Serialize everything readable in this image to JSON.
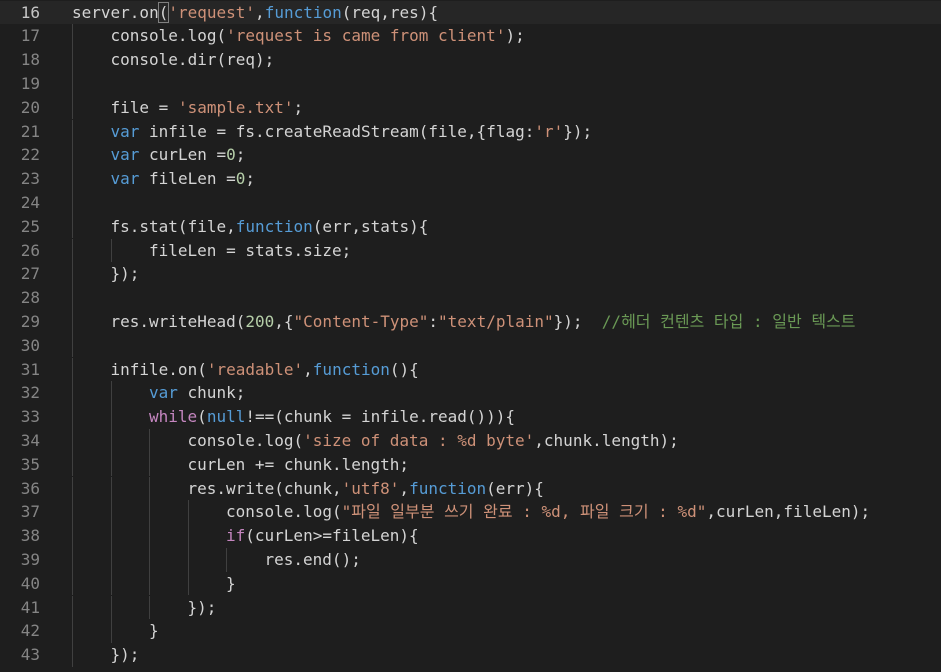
{
  "editor": {
    "current_line": 16,
    "lines": [
      {
        "n": "16",
        "indent": 0,
        "tokens": [
          {
            "t": "server.on",
            "c": "plain"
          },
          {
            "t": "(",
            "c": "br"
          },
          {
            "t": "'request'",
            "c": "str"
          },
          {
            "t": ",",
            "c": "plain"
          },
          {
            "t": "function",
            "c": "kw"
          },
          {
            "t": "(req,res){",
            "c": "plain"
          }
        ]
      },
      {
        "n": "17",
        "indent": 1,
        "tokens": [
          {
            "t": "console.log(",
            "c": "plain"
          },
          {
            "t": "'request is came from client'",
            "c": "str"
          },
          {
            "t": ");",
            "c": "plain"
          }
        ]
      },
      {
        "n": "18",
        "indent": 1,
        "tokens": [
          {
            "t": "console.dir(req);",
            "c": "plain"
          }
        ]
      },
      {
        "n": "19",
        "indent": 0,
        "tokens": []
      },
      {
        "n": "20",
        "indent": 1,
        "tokens": [
          {
            "t": "file = ",
            "c": "plain"
          },
          {
            "t": "'sample.txt'",
            "c": "str"
          },
          {
            "t": ";",
            "c": "plain"
          }
        ]
      },
      {
        "n": "21",
        "indent": 1,
        "tokens": [
          {
            "t": "var",
            "c": "kw"
          },
          {
            "t": " infile = fs.createReadStream(file,{flag:",
            "c": "plain"
          },
          {
            "t": "'r'",
            "c": "str"
          },
          {
            "t": "});",
            "c": "plain"
          }
        ]
      },
      {
        "n": "22",
        "indent": 1,
        "tokens": [
          {
            "t": "var",
            "c": "kw"
          },
          {
            "t": " curLen =",
            "c": "plain"
          },
          {
            "t": "0",
            "c": "num"
          },
          {
            "t": ";",
            "c": "plain"
          }
        ]
      },
      {
        "n": "23",
        "indent": 1,
        "tokens": [
          {
            "t": "var",
            "c": "kw"
          },
          {
            "t": " fileLen =",
            "c": "plain"
          },
          {
            "t": "0",
            "c": "num"
          },
          {
            "t": ";",
            "c": "plain"
          }
        ]
      },
      {
        "n": "24",
        "indent": 0,
        "tokens": []
      },
      {
        "n": "25",
        "indent": 1,
        "tokens": [
          {
            "t": "fs.stat(file,",
            "c": "plain"
          },
          {
            "t": "function",
            "c": "kw"
          },
          {
            "t": "(err,stats){",
            "c": "plain"
          }
        ]
      },
      {
        "n": "26",
        "indent": 2,
        "tokens": [
          {
            "t": "fileLen = stats.size;",
            "c": "plain"
          }
        ]
      },
      {
        "n": "27",
        "indent": 1,
        "tokens": [
          {
            "t": "});",
            "c": "plain"
          }
        ]
      },
      {
        "n": "28",
        "indent": 0,
        "tokens": []
      },
      {
        "n": "29",
        "indent": 1,
        "tokens": [
          {
            "t": "res.writeHead(",
            "c": "plain"
          },
          {
            "t": "200",
            "c": "num"
          },
          {
            "t": ",{",
            "c": "plain"
          },
          {
            "t": "\"Content-Type\"",
            "c": "str"
          },
          {
            "t": ":",
            "c": "plain"
          },
          {
            "t": "\"text/plain\"",
            "c": "str"
          },
          {
            "t": "});  ",
            "c": "plain"
          },
          {
            "t": "//헤더 컨텐츠 타입 : 일반 텍스트",
            "c": "cmt"
          }
        ]
      },
      {
        "n": "30",
        "indent": 0,
        "tokens": []
      },
      {
        "n": "31",
        "indent": 1,
        "tokens": [
          {
            "t": "infile.on(",
            "c": "plain"
          },
          {
            "t": "'readable'",
            "c": "str"
          },
          {
            "t": ",",
            "c": "plain"
          },
          {
            "t": "function",
            "c": "kw"
          },
          {
            "t": "(){",
            "c": "plain"
          }
        ]
      },
      {
        "n": "32",
        "indent": 2,
        "tokens": [
          {
            "t": "var",
            "c": "kw"
          },
          {
            "t": " chunk;",
            "c": "plain"
          }
        ]
      },
      {
        "n": "33",
        "indent": 2,
        "tokens": [
          {
            "t": "while",
            "c": "ctl"
          },
          {
            "t": "(",
            "c": "plain"
          },
          {
            "t": "null",
            "c": "kw"
          },
          {
            "t": "!==(chunk = infile.read())){",
            "c": "plain"
          }
        ]
      },
      {
        "n": "34",
        "indent": 3,
        "tokens": [
          {
            "t": "console.log(",
            "c": "plain"
          },
          {
            "t": "'size of data : %d byte'",
            "c": "str"
          },
          {
            "t": ",chunk.length);",
            "c": "plain"
          }
        ]
      },
      {
        "n": "35",
        "indent": 3,
        "tokens": [
          {
            "t": "curLen += chunk.length;",
            "c": "plain"
          }
        ]
      },
      {
        "n": "36",
        "indent": 3,
        "tokens": [
          {
            "t": "res.write(chunk,",
            "c": "plain"
          },
          {
            "t": "'utf8'",
            "c": "str"
          },
          {
            "t": ",",
            "c": "plain"
          },
          {
            "t": "function",
            "c": "kw"
          },
          {
            "t": "(err){",
            "c": "plain"
          }
        ]
      },
      {
        "n": "37",
        "indent": 4,
        "tokens": [
          {
            "t": "console.log(",
            "c": "plain"
          },
          {
            "t": "\"파일 일부분 쓰기 완료 : %d, 파일 크기 : %d\"",
            "c": "str"
          },
          {
            "t": ",curLen,fileLen);",
            "c": "plain"
          }
        ]
      },
      {
        "n": "38",
        "indent": 4,
        "tokens": [
          {
            "t": "if",
            "c": "ctl"
          },
          {
            "t": "(curLen>=fileLen){",
            "c": "plain"
          }
        ]
      },
      {
        "n": "39",
        "indent": 5,
        "tokens": [
          {
            "t": "res.end();",
            "c": "plain"
          }
        ]
      },
      {
        "n": "40",
        "indent": 4,
        "tokens": [
          {
            "t": "}",
            "c": "plain"
          }
        ]
      },
      {
        "n": "41",
        "indent": 3,
        "tokens": [
          {
            "t": "});",
            "c": "plain"
          }
        ]
      },
      {
        "n": "42",
        "indent": 2,
        "tokens": [
          {
            "t": "}",
            "c": "plain"
          }
        ]
      },
      {
        "n": "43",
        "indent": 1,
        "tokens": [
          {
            "t": "});",
            "c": "plain"
          }
        ]
      }
    ]
  }
}
